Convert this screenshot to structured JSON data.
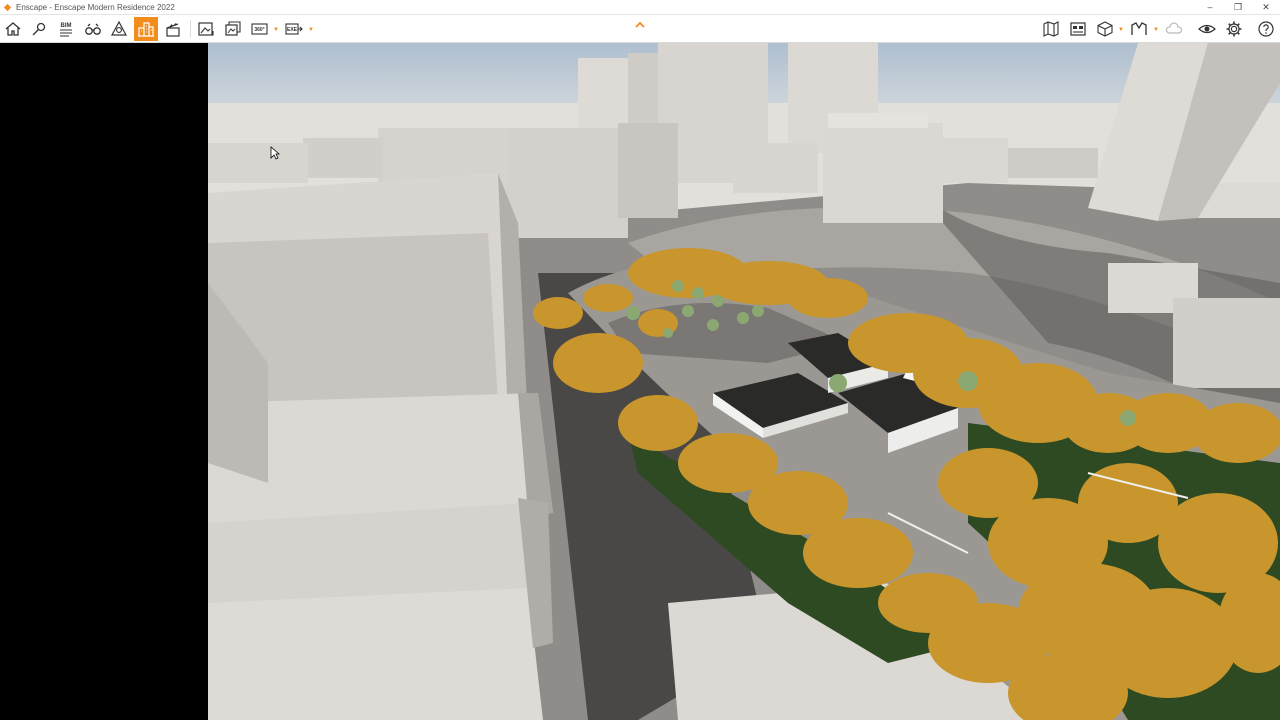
{
  "window": {
    "title": "Enscape - Enscape Modern Residence 2022"
  },
  "window_controls": [
    "minimize-icon",
    "restore-icon",
    "close-icon"
  ],
  "toolbar_left": [
    {
      "name": "home-button",
      "icon": "home-icon"
    },
    {
      "name": "navigation-button",
      "icon": "location-pin-icon"
    },
    {
      "name": "bim-info-button",
      "icon": "bim-icon",
      "label": "BIM"
    },
    {
      "name": "binoculars-button",
      "icon": "binoculars-icon"
    },
    {
      "name": "compass-button",
      "icon": "compass-icon"
    },
    {
      "name": "site-context-button",
      "icon": "buildings-icon",
      "active": true
    },
    {
      "name": "video-editor-button",
      "icon": "clapperboard-icon"
    },
    {
      "name": "render-image-button",
      "icon": "render-image-icon"
    },
    {
      "name": "batch-render-button",
      "icon": "batch-render-icon"
    },
    {
      "name": "panorama-button",
      "icon": "panorama-360-icon",
      "label": "360°"
    },
    {
      "name": "export-button",
      "icon": "export-icon",
      "label": "EXE"
    }
  ],
  "toolbar_right": [
    {
      "name": "asset-map-button",
      "icon": "map-icon"
    },
    {
      "name": "asset-library-button",
      "icon": "library-icon"
    },
    {
      "name": "view-management-button",
      "icon": "cube-icon"
    },
    {
      "name": "material-editor-button",
      "icon": "material-icon"
    },
    {
      "name": "collaboration-button",
      "icon": "cloud-icon"
    },
    {
      "name": "visual-settings-button",
      "icon": "eye-icon"
    },
    {
      "name": "settings-button",
      "icon": "gear-icon"
    },
    {
      "name": "help-button",
      "icon": "help-icon"
    }
  ],
  "colors": {
    "accent": "#f28c1c",
    "sky": "#b9c8d6",
    "massing": "#d4d0cb",
    "ground": "#8f8c89",
    "foliage": "#c8962c",
    "grass": "#2e4a22",
    "roof": "#2a2a28"
  },
  "viewport": {
    "scene": "aerial-view-site-context"
  }
}
